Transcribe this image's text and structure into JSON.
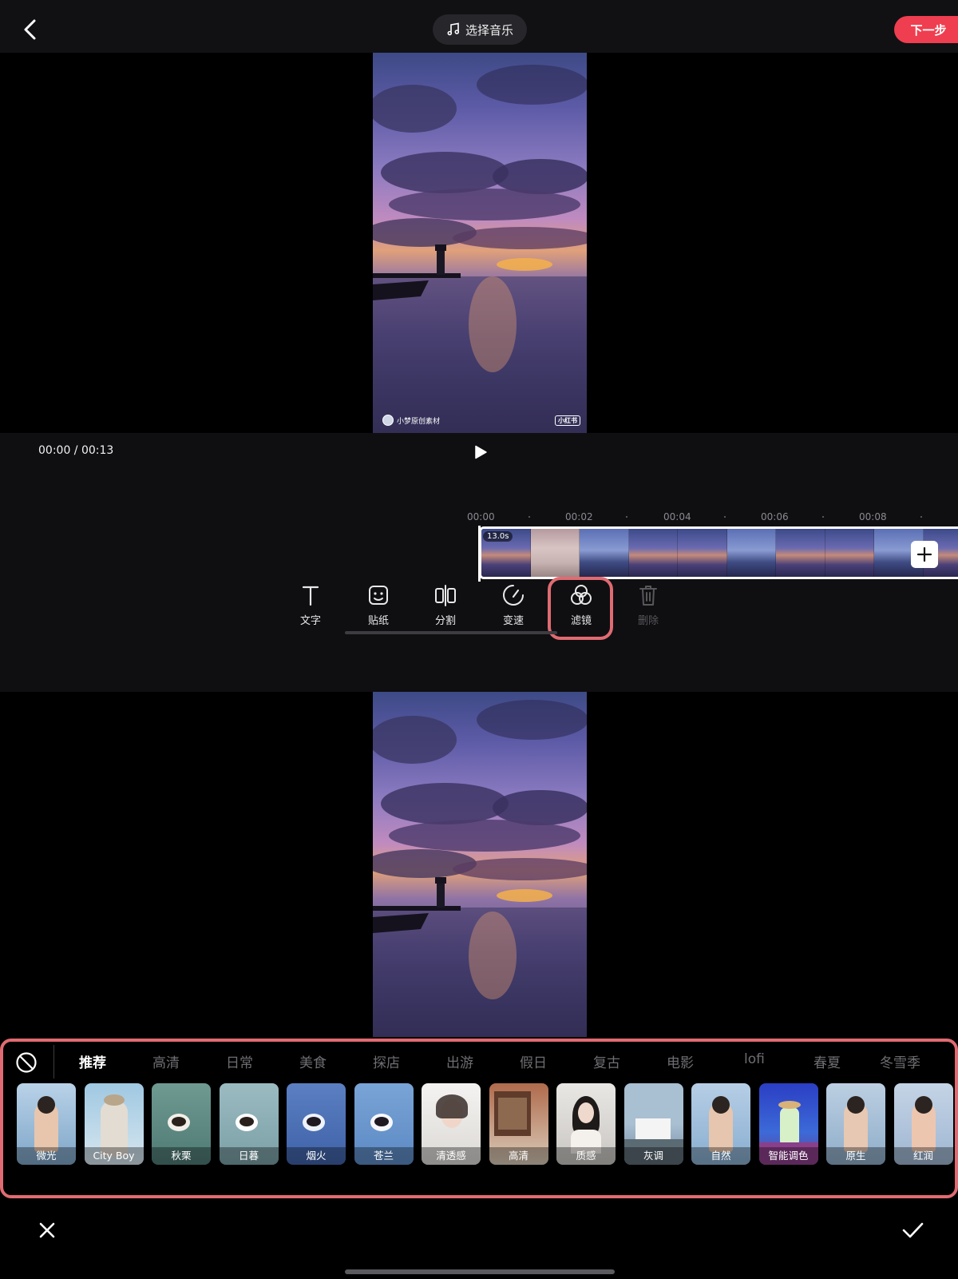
{
  "topbar": {
    "music_label": "选择音乐",
    "next_label": "下一步"
  },
  "preview": {
    "watermark_author": "小梦原创素材",
    "watermark_badge": "小红书"
  },
  "player": {
    "timecode": "00:00 / 00:13"
  },
  "timeline": {
    "ticks": [
      "00:00",
      "00:02",
      "00:04",
      "00:06",
      "00:08"
    ],
    "clip_duration": "13.0s"
  },
  "tools": [
    {
      "label": "文字",
      "icon": "text-icon",
      "enabled": true
    },
    {
      "label": "贴纸",
      "icon": "sticker-icon",
      "enabled": true
    },
    {
      "label": "分割",
      "icon": "split-icon",
      "enabled": true
    },
    {
      "label": "变速",
      "icon": "speed-icon",
      "enabled": true
    },
    {
      "label": "滤镜",
      "icon": "filter-icon",
      "enabled": true,
      "highlighted": true
    },
    {
      "label": "删除",
      "icon": "trash-icon",
      "enabled": false
    }
  ],
  "filter_tabs": [
    "推荐",
    "高清",
    "日常",
    "美食",
    "探店",
    "出游",
    "假日",
    "复古",
    "电影",
    "lofi",
    "春夏",
    "冬雪季"
  ],
  "active_filter_tab": "推荐",
  "filters": [
    "微光",
    "City Boy",
    "秋栗",
    "日暮",
    "烟火",
    "苍兰",
    "清透感",
    "高清",
    "质感",
    "灰调",
    "自然",
    "智能调色",
    "原生",
    "红润"
  ],
  "colors": {
    "accent": "#ef3e4f",
    "highlight_outline": "#e06b72",
    "panel_bg": "#0f0f12"
  }
}
